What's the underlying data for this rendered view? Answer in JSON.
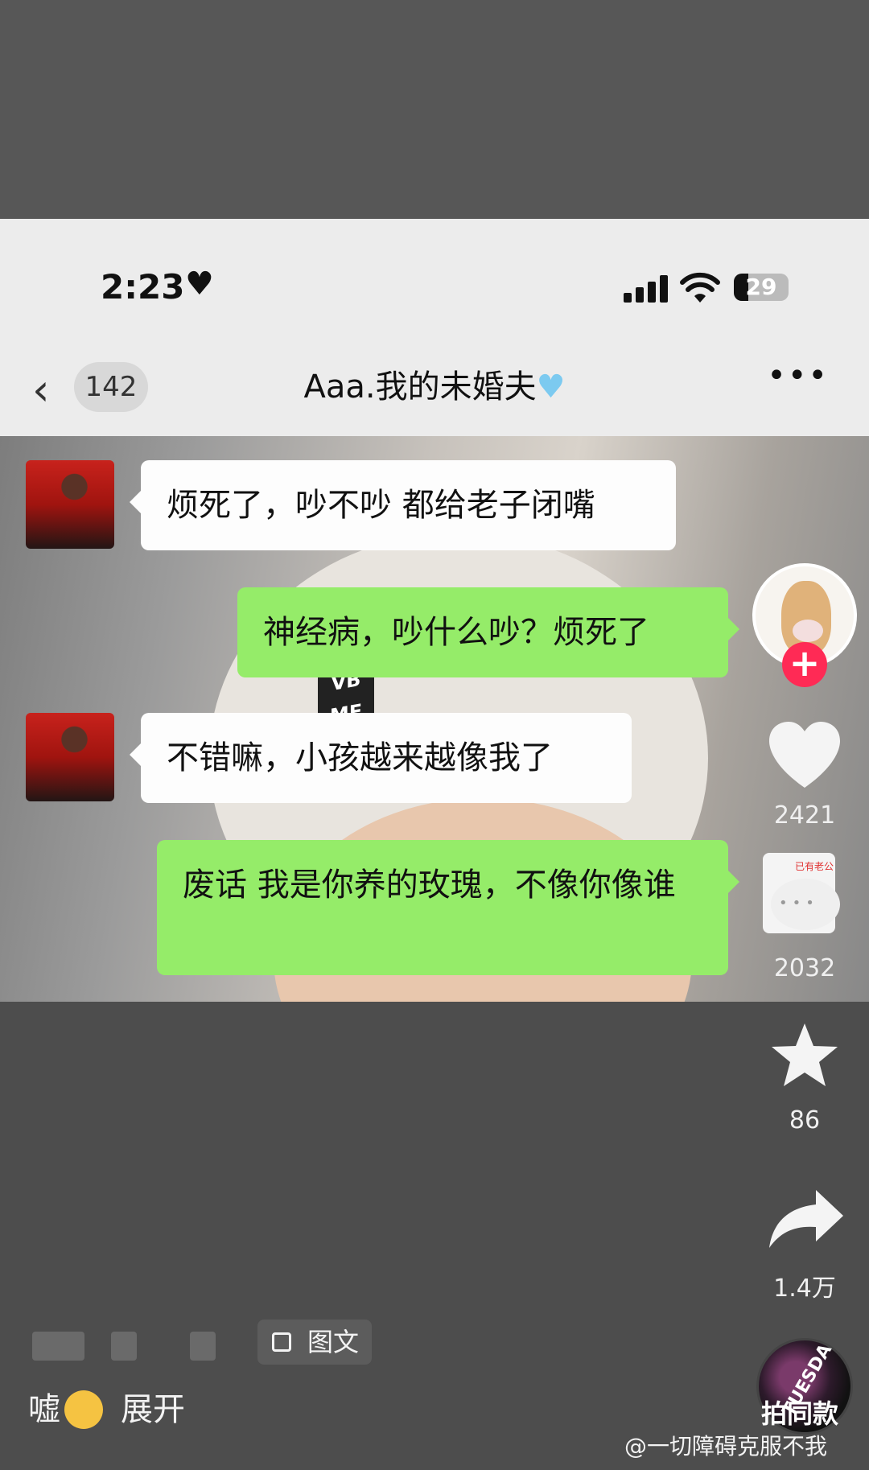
{
  "status_bar": {
    "time": "2:23",
    "battery": "29"
  },
  "chat_header": {
    "back_count": "142",
    "title": "Aaa.我的未婚夫"
  },
  "messages": [
    {
      "from": "other",
      "text": "烦死了，吵不吵 都给老子闭嘴"
    },
    {
      "from": "me",
      "text": "神经病，吵什么吵？烦死了"
    },
    {
      "from": "other",
      "text": "不错嘛，小孩越来越像我了"
    },
    {
      "from": "me",
      "text": "废话 我是你养的玫瑰，不像你像谁"
    }
  ],
  "photo_background": {
    "hat_patch_text": "VB ME"
  },
  "right_rail": {
    "likes": "2421",
    "comments": "2032",
    "comment_thumb_text": "已有老公",
    "favorites": "86",
    "shares": "1.4万",
    "same_style_label": "拍同款",
    "music_disc_text": "TUESDA"
  },
  "bottom": {
    "tag_label": "图文",
    "caption": "嘘",
    "expand_label": "展开",
    "watermark": "@一切障碍克服不我"
  },
  "colors": {
    "my_bubble": "#95ec69",
    "other_bubble": "#fdfdfd",
    "follow_button": "#ff2a55",
    "title_heart": "#7ccaf0"
  }
}
